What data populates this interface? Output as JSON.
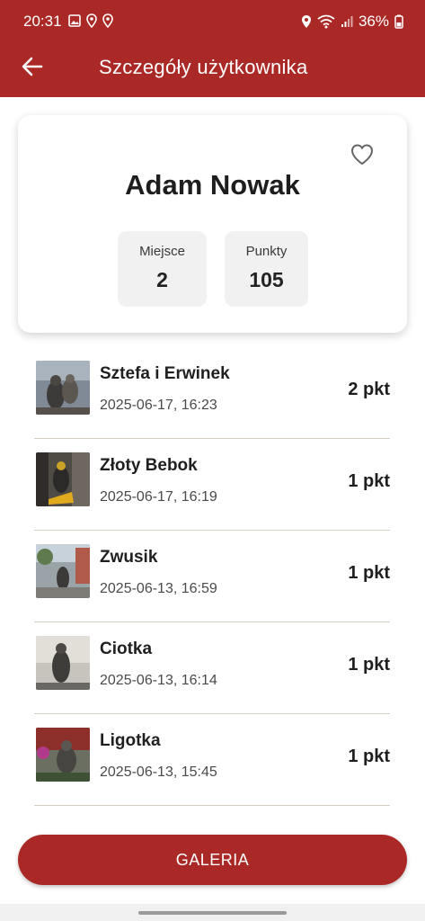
{
  "status_bar": {
    "time": "20:31",
    "battery": "36%",
    "icons": [
      "image-icon",
      "location-pin-icon",
      "location-pin-icon",
      "location-icon",
      "wifi-icon",
      "signal-icon",
      "battery-icon"
    ]
  },
  "app_bar": {
    "title": "Szczegóły użytkownika",
    "back_icon": "arrow-left-icon",
    "color": "#aa2927"
  },
  "profile": {
    "name": "Adam Nowak",
    "favorite_icon": "heart-outline-icon",
    "stats": [
      {
        "label": "Miejsce",
        "value": "2"
      },
      {
        "label": "Punkty",
        "value": "105"
      }
    ]
  },
  "entries": [
    {
      "name": "Sztefa i Erwinek",
      "date": "2025-06-17, 16:23",
      "points": "2 pkt"
    },
    {
      "name": "Złoty Bebok",
      "date": "2025-06-17, 16:19",
      "points": "1 pkt"
    },
    {
      "name": "Zwusik",
      "date": "2025-06-13, 16:59",
      "points": "1 pkt"
    },
    {
      "name": "Ciotka",
      "date": "2025-06-13, 16:14",
      "points": "1 pkt"
    },
    {
      "name": "Ligotka",
      "date": "2025-06-13, 15:45",
      "points": "1 pkt"
    }
  ],
  "gallery_button": {
    "label": "GALERIA"
  }
}
